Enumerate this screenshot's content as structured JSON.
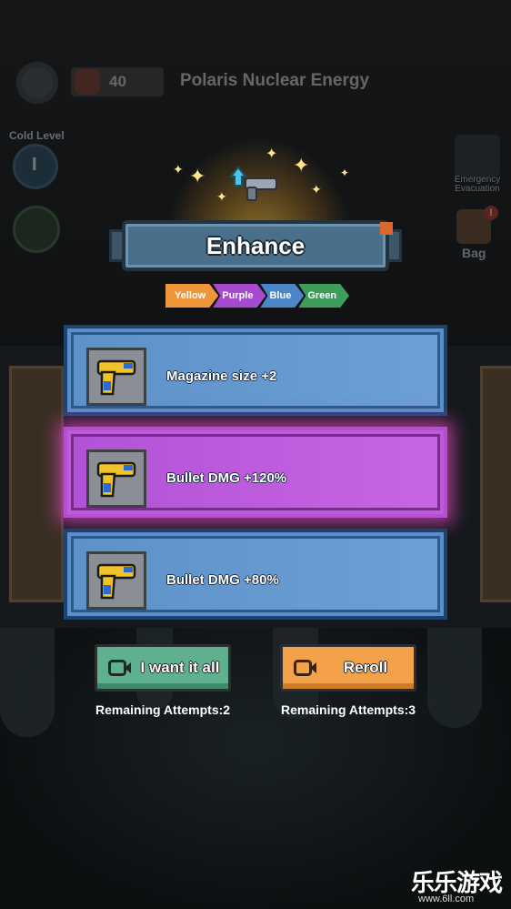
{
  "hud": {
    "coins": "40",
    "zone_title": "Polaris Nuclear Energy",
    "cold_level_label": "Cold Level",
    "cold_level_value": "I",
    "evacuation_label": "Emergency Evacuation",
    "bag_label": "Bag",
    "bag_badge": "!"
  },
  "enhance": {
    "title": "Enhance",
    "tiers": [
      {
        "label": "Yellow",
        "color": "#f0963a"
      },
      {
        "label": "Purple",
        "color": "#a64bd0"
      },
      {
        "label": "Blue",
        "color": "#4a86c8"
      },
      {
        "label": "Green",
        "color": "#3d9e5c"
      }
    ],
    "options": [
      {
        "label": "Magazine size +2",
        "tier": "Blue",
        "selected": false
      },
      {
        "label": "Bullet DMG +120%",
        "tier": "Purple",
        "selected": true
      },
      {
        "label": "Bullet DMG +80%",
        "tier": "Blue",
        "selected": false
      }
    ]
  },
  "actions": {
    "take_all": {
      "label": "I want it all",
      "attempts": "Remaining Attempts:2",
      "color": "#5fb08e"
    },
    "reroll": {
      "label": "Reroll",
      "attempts": "Remaining Attempts:3",
      "color": "#f3a14a"
    }
  },
  "watermark": {
    "main": "乐乐游戏",
    "sub": "www.6ll.com"
  }
}
